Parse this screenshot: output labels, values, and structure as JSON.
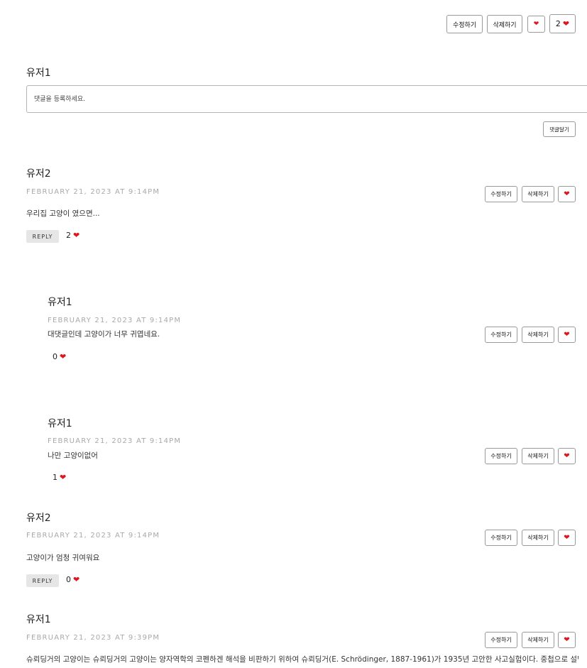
{
  "post_actions": {
    "edit": "수정하기",
    "delete": "삭제하기",
    "heart": "❤",
    "like_count": "2",
    "like_heart": "❤"
  },
  "comment_form": {
    "user": "유저1",
    "placeholder": "댓글을 등록하세요.",
    "submit": "댓글달기"
  },
  "comments": [
    {
      "author": "유저2",
      "date": "FEBRUARY 21, 2023 AT 9:14PM",
      "text": "우리집 고양이 였으면...",
      "reply": "REPLY",
      "likes": "2",
      "edit": "수정하기",
      "delete": "삭제하기",
      "heart": "❤"
    },
    {
      "author": "유저1",
      "date": "FEBRUARY 21, 2023 AT 9:14PM",
      "text": "대댓글인데 고양이가 너무 귀엽네요.",
      "likes": "0",
      "edit": "수정하기",
      "delete": "삭제하기",
      "heart": "❤"
    },
    {
      "author": "유저1",
      "date": "FEBRUARY 21, 2023 AT 9:14PM",
      "text": "나만 고양이없어",
      "likes": "1",
      "edit": "수정하기",
      "delete": "삭제하기",
      "heart": "❤"
    },
    {
      "author": "유저2",
      "date": "FEBRUARY 21, 2023 AT 9:14PM",
      "text": "고양이가 엄청 귀여워요",
      "reply": "REPLY",
      "likes": "0",
      "edit": "수정하기",
      "delete": "삭제하기",
      "heart": "❤"
    },
    {
      "author": "유저1",
      "date": "FEBRUARY 21, 2023 AT 9:39PM",
      "text": "슈뢰딩거의 고양이는 슈뢰딩거의 고양이는 양자역학의 코펜하겐 해석을 비판하기 위하여 슈뢰딩거(E. Schrödinger, 1887-1961)가 1935년 고안한 사고실험이다. 중첩으로 설명",
      "edit": "수정하기",
      "delete": "삭제하기",
      "heart": "❤"
    }
  ],
  "colors": {
    "heart": "#e0161f",
    "date": "#a9a9a9",
    "reply_bg": "#e6e6e6"
  }
}
